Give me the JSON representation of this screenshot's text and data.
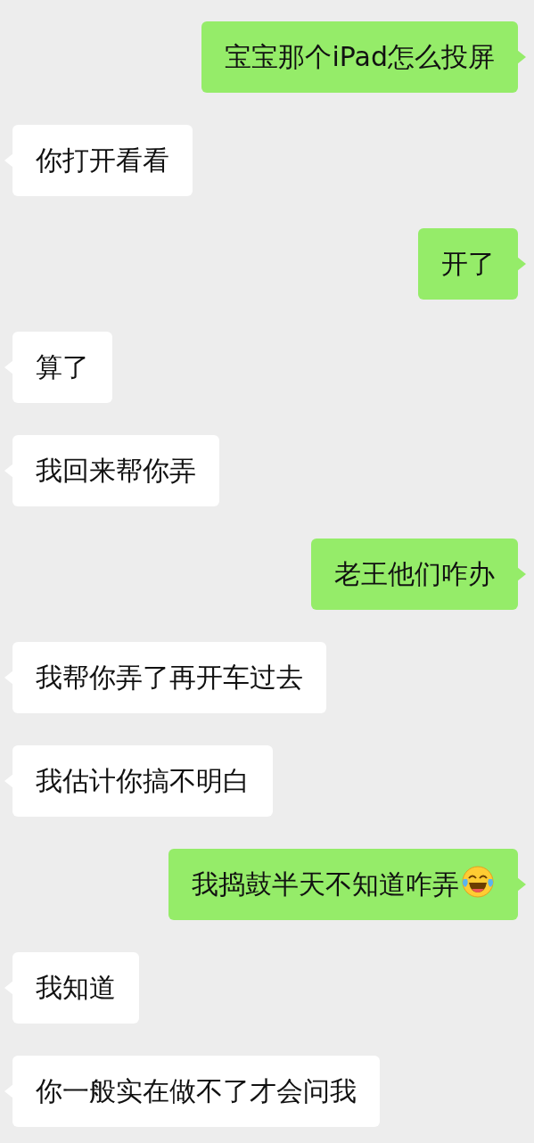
{
  "messages": [
    {
      "outgoing": true,
      "text": "宝宝那个iPad怎么投屏"
    },
    {
      "outgoing": false,
      "text": "你打开看看"
    },
    {
      "outgoing": true,
      "text": "开了"
    },
    {
      "outgoing": false,
      "text": "算了"
    },
    {
      "outgoing": false,
      "text": "我回来帮你弄"
    },
    {
      "outgoing": true,
      "text": "老王他们咋办"
    },
    {
      "outgoing": false,
      "text": "我帮你弄了再开车过去"
    },
    {
      "outgoing": false,
      "text": "我估计你搞不明白"
    },
    {
      "outgoing": true,
      "text": "我捣鼓半天不知道咋弄",
      "emoji": true
    },
    {
      "outgoing": false,
      "text": "我知道"
    },
    {
      "outgoing": false,
      "text": "你一般实在做不了才会问我"
    }
  ]
}
